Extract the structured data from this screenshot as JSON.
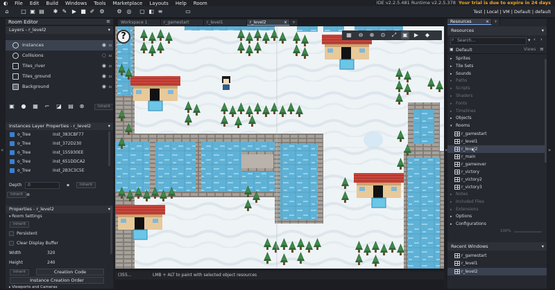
{
  "menu": [
    "File",
    "Edit",
    "Build",
    "Windows",
    "Tools",
    "Marketplace",
    "Layouts",
    "Help",
    "Room"
  ],
  "version": "IDE v2.2.5.481  Runtime v2.2.5.378",
  "trial": "Your trial is due to expire in 24 days",
  "target": "Test | Local | VM | Default | default",
  "room_editor": {
    "title": "Room Editor",
    "layers_title": "Layers - r_level2",
    "layers": [
      "Instances",
      "Collisions",
      "Tiles_river",
      "Tiles_ground",
      "Background"
    ],
    "inherit": "Inherit",
    "instance_props_title": "Instances Layer Properties - r_level2",
    "instances": [
      {
        "obj": "o_Tree",
        "id": "inst_383CBF77"
      },
      {
        "obj": "o_Tree",
        "id": "inst_372D230"
      },
      {
        "obj": "o_Tree",
        "id": "inst_155930EE"
      },
      {
        "obj": "o_Tree",
        "id": "inst_651DDCA2"
      },
      {
        "obj": "o_Tree",
        "id": "inst_2B3C3C5E"
      }
    ],
    "depth_label": "Depth",
    "depth_value": "0",
    "properties_title": "Properties - r_level2",
    "room_settings": "Room Settings",
    "persistent": "Persistent",
    "clear_display": "Clear Display Buffer",
    "width_label": "Width",
    "width_value": "320",
    "height_label": "Height",
    "height_value": "240",
    "creation_code": "Creation Code",
    "instance_order": "Instance Creation Order",
    "viewports": "Viewports and Cameras"
  },
  "tabs": [
    "Workspace 1",
    "r_gamestart",
    "r_level1",
    "r_level2"
  ],
  "status": {
    "coords": "(355...",
    "hint": "LMB + ALT to paint with selected object resources"
  },
  "resources": {
    "title": "Resources",
    "header": "Resources",
    "search_placeholder": "Search...",
    "default": "Default",
    "views": "Views",
    "groups": [
      {
        "label": "Sprites",
        "dim": false
      },
      {
        "label": "Tile Sets",
        "dim": false
      },
      {
        "label": "Sounds",
        "dim": false
      },
      {
        "label": "Paths",
        "dim": true
      },
      {
        "label": "Scripts",
        "dim": true
      },
      {
        "label": "Shaders",
        "dim": true
      },
      {
        "label": "Fonts",
        "dim": true
      },
      {
        "label": "Timelines",
        "dim": true
      },
      {
        "label": "Objects",
        "dim": false
      },
      {
        "label": "Rooms",
        "dim": false
      }
    ],
    "rooms": [
      "r_gamestart",
      "r_level1",
      "r_level2",
      "r_main",
      "r_gameover",
      "r_victory",
      "r_victory2",
      "r_victory3"
    ],
    "after": [
      {
        "label": "Notes",
        "dim": true
      },
      {
        "label": "Included Files",
        "dim": true
      },
      {
        "label": "Extensions",
        "dim": true
      },
      {
        "label": "Options",
        "dim": false
      },
      {
        "label": "Configurations",
        "dim": false
      }
    ],
    "zoom": "100%",
    "recent_title": "Recent Windows",
    "recent": [
      "r_gamestart",
      "r_level1",
      "r_level2"
    ]
  }
}
